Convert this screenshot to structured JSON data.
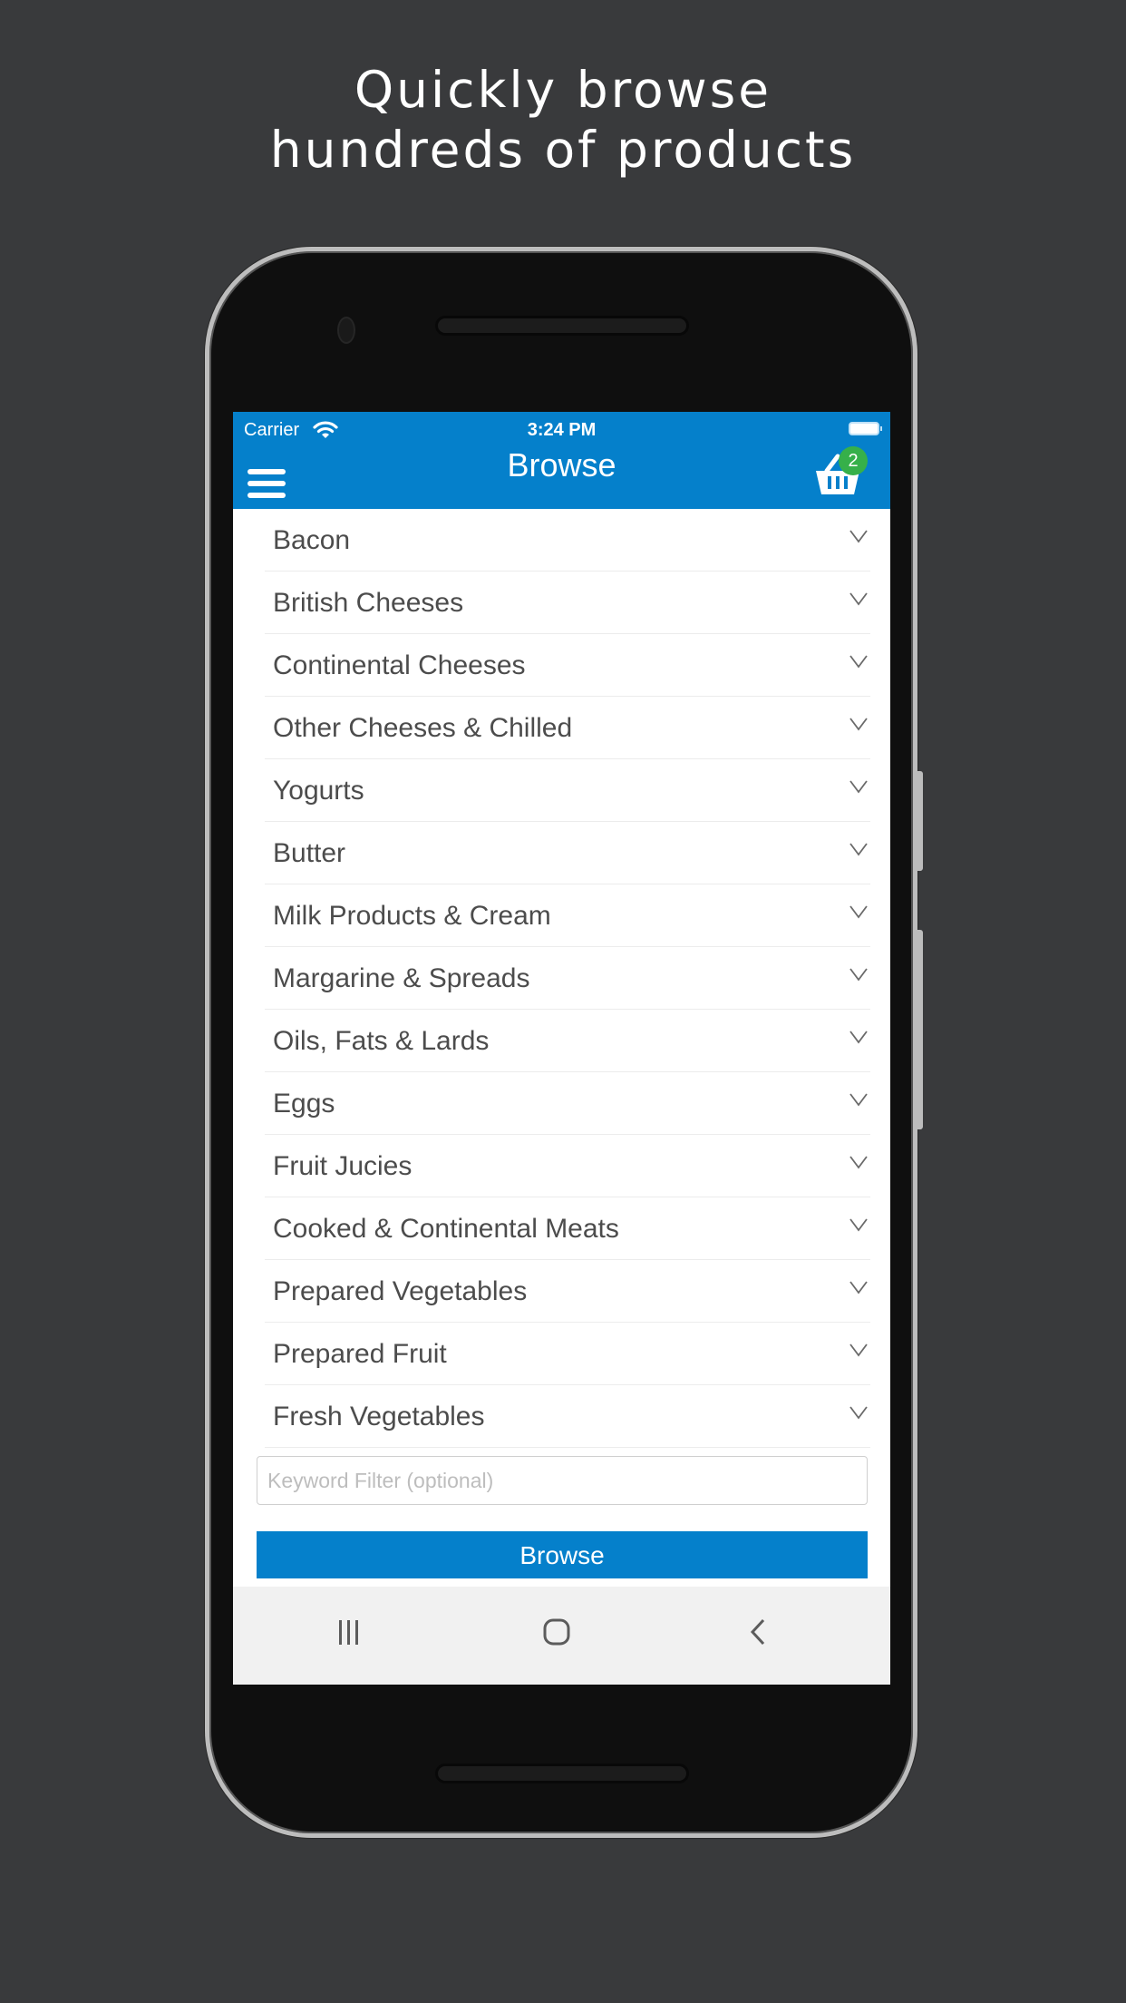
{
  "headline": {
    "line1": "Quickly browse",
    "line2": "hundreds of products"
  },
  "status_bar": {
    "carrier": "Carrier",
    "time": "3:24 PM",
    "wifi_icon": "wifi-icon",
    "battery_icon": "battery-icon"
  },
  "app_bar": {
    "title": "Browse",
    "menu_icon": "menu-icon",
    "cart_icon": "basket-icon",
    "cart_count": "2",
    "colors": {
      "primary": "#0580cb",
      "badge": "#36b04a"
    }
  },
  "categories": [
    {
      "label": "Bacon"
    },
    {
      "label": "British Cheeses"
    },
    {
      "label": "Continental Cheeses"
    },
    {
      "label": "Other Cheeses & Chilled"
    },
    {
      "label": "Yogurts"
    },
    {
      "label": "Butter"
    },
    {
      "label": "Milk Products & Cream"
    },
    {
      "label": "Margarine & Spreads"
    },
    {
      "label": "Oils, Fats & Lards"
    },
    {
      "label": "Eggs"
    },
    {
      "label": "Fruit Jucies"
    },
    {
      "label": "Cooked & Continental Meats"
    },
    {
      "label": "Prepared Vegetables"
    },
    {
      "label": "Prepared Fruit"
    },
    {
      "label": "Fresh Vegetables"
    }
  ],
  "filter": {
    "value": "",
    "placeholder": "Keyword Filter (optional)"
  },
  "browse_button": {
    "label": "Browse"
  },
  "nav_bar": {
    "recent_icon": "recent-apps-icon",
    "home_icon": "home-icon",
    "back_icon": "back-icon"
  }
}
